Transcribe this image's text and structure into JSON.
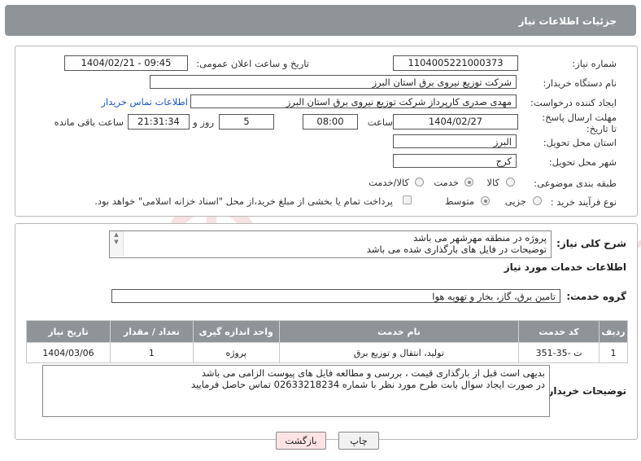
{
  "header": {
    "title": "جزئیات اطلاعات نیاز"
  },
  "form": {
    "need_number_label": "شماره نیاز:",
    "need_number": "1104005221000373",
    "announce_label": "تاریخ و ساعت اعلان عمومی:",
    "announce_value": "1404/02/21 - 09:45",
    "buyer_org_label": "نام دستگاه خریدار:",
    "buyer_org": "شرکت توزیع نیروی برق استان البرز",
    "requester_label": "ایجاد کننده درخواست:",
    "requester": "مهدی صدری کارپرداز شرکت توزیع نیروی برق استان البرز",
    "contact_link": "اطلاعات تماس خریدار",
    "deadline_label": "مهلت ارسال پاسخ: تا تاریخ:",
    "deadline_date": "1404/02/27",
    "time_label": "ساعت",
    "deadline_time": "08:00",
    "days_value": "5",
    "days_label": "روز و",
    "remaining_time": "21:31:34",
    "remaining_label": "ساعت باقی مانده",
    "province_label": "استان محل تحویل:",
    "province": "البرز",
    "city_label": "شهر محل تحویل:",
    "city": "کرج",
    "category_label": "طبقه بندی موضوعی:",
    "category_options": [
      "کالا",
      "خدمت",
      "کالا/خدمت"
    ],
    "category_selected": "خدمت",
    "process_label": "نوع فرآیند خرید :",
    "process_options": [
      "جزیی",
      "متوسط"
    ],
    "process_selected": "متوسط",
    "payment_note": "پرداخت تمام یا بخشی از مبلغ خرید،از محل \"اسناد خزانه اسلامی\" خواهد بود."
  },
  "description": {
    "label": "شرح کلی نیاز:",
    "lines": [
      "پروژه در منطقه مهرشهر می باشد",
      "توضیحات در فایل های بارگذاری شده می باشد"
    ]
  },
  "services": {
    "section_title": "اطلاعات خدمات مورد نیاز",
    "group_label": "گروه خدمت:",
    "group_value": "تامین برق، گاز، بخار و تهویه هوا",
    "columns": [
      "ردیف",
      "کد خدمت",
      "نام خدمت",
      "واحد اندازه گیری",
      "تعداد / مقدار",
      "تاریخ نیاز"
    ],
    "rows": [
      {
        "row": "1",
        "code": "ت -35-351",
        "name": "تولید، انتقال و توزیع برق",
        "unit": "پروژه",
        "qty": "1",
        "date": "1404/03/06"
      }
    ]
  },
  "buyer_notes": {
    "label": "توضیحات خریدار:",
    "lines": [
      "بدیهی است قبل از بارگذاری قیمت ، بررسی و مطالعه فایل های پیوست الزامی می باشد",
      "در صورت ایجاد سوال بابت طرح مورد نظر با شماره 02633218234 تماس حاصل فرمایید"
    ]
  },
  "buttons": {
    "print": "چاپ",
    "back": "بازگشت"
  },
  "watermark": {
    "text": "AriaTender.neT"
  },
  "colors": {
    "header_bg": "#8f9499",
    "link": "#1a55c8",
    "back_button_bg": "#fde4e4",
    "watermark": "#c0282d"
  }
}
